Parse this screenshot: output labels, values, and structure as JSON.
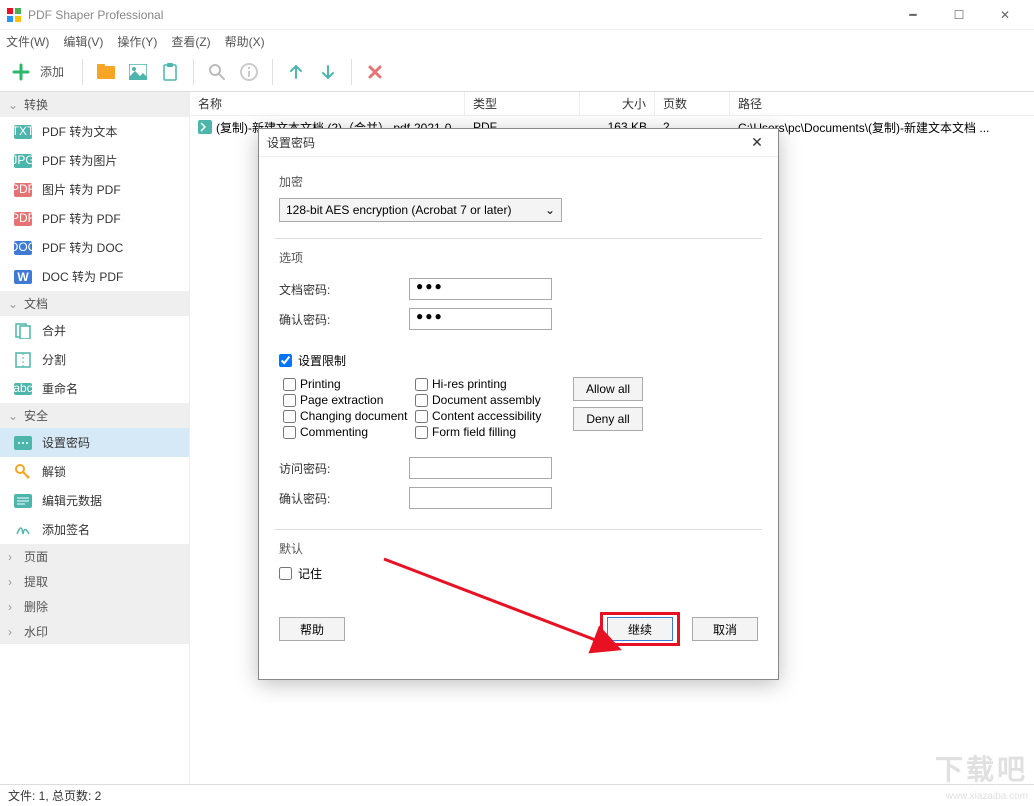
{
  "window": {
    "title": "PDF Shaper Professional"
  },
  "menu": {
    "file": "文件(W)",
    "edit": "编辑(V)",
    "action": "操作(Y)",
    "view": "查看(Z)",
    "help": "帮助(X)"
  },
  "toolbar": {
    "add": "添加"
  },
  "sidebar": {
    "convert": {
      "title": "转换",
      "items": [
        "PDF 转为文本",
        "PDF 转为图片",
        "图片 转为 PDF",
        "PDF 转为 PDF",
        "PDF 转为 DOC",
        "DOC 转为 PDF"
      ]
    },
    "document": {
      "title": "文档",
      "items": [
        "合并",
        "分割",
        "重命名"
      ]
    },
    "security": {
      "title": "安全",
      "items": [
        "设置密码",
        "解锁",
        "编辑元数据",
        "添加签名"
      ]
    },
    "others": [
      "页面",
      "提取",
      "删除",
      "水印"
    ]
  },
  "list": {
    "columns": {
      "name": "名称",
      "type": "类型",
      "size": "大小",
      "pages": "页数",
      "path": "路径"
    },
    "rows": [
      {
        "name": "(复制)-新建文本文档 (2)（合并）.pdf-2021-0",
        "type": "PDF",
        "size": "163 KB",
        "pages": "2",
        "path": "C:\\Users\\pc\\Documents\\(复制)-新建文本文档 ..."
      }
    ]
  },
  "statusbar": {
    "text": "文件: 1, 总页数: 2"
  },
  "dialog": {
    "title": "设置密码",
    "encryption": {
      "label": "加密",
      "selected": "128-bit AES encryption (Acrobat 7 or later)"
    },
    "options": {
      "label": "选项",
      "doc_password_lbl": "文档密码:",
      "confirm_password_lbl": "确认密码:",
      "doc_password_val": "●●●",
      "confirm_password_val": "●●●",
      "set_restrictions": "设置限制",
      "perms": {
        "printing": "Printing",
        "page_extraction": "Page extraction",
        "changing_document": "Changing document",
        "commenting": "Commenting",
        "hires_printing": "Hi-res printing",
        "document_assembly": "Document assembly",
        "content_accessibility": "Content accessibility",
        "form_field_filling": "Form field filling"
      },
      "allow_all": "Allow all",
      "deny_all": "Deny all",
      "access_password_lbl": "访问密码:",
      "access_confirm_lbl": "确认密码:"
    },
    "defaults": {
      "label": "默认",
      "remember": "记住"
    },
    "buttons": {
      "help": "帮助",
      "continue": "继续",
      "cancel": "取消"
    }
  },
  "watermark": {
    "big": "下载吧",
    "url": "www.xiazaiba.com"
  }
}
